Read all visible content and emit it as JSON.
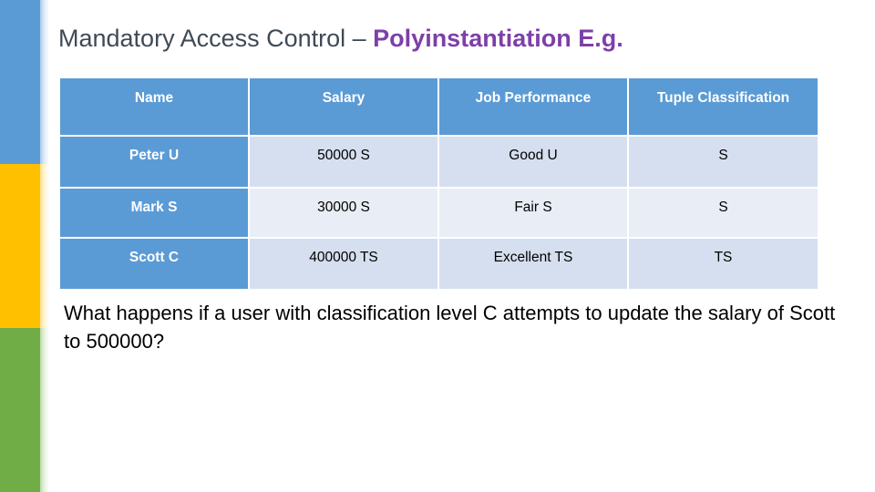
{
  "slide": {
    "title_main": "Mandatory Access Control – ",
    "title_accent": "Polyinstantiation E.g.",
    "question": "What happens if a user with classification level C attempts to update the salary of Scott to 500000?"
  },
  "decor": {
    "band_blue_color": "#5b9bd5",
    "band_yellow_color": "#ffc000",
    "band_green_color": "#70ad47"
  },
  "table": {
    "headers": [
      "Name",
      "Salary",
      "Job Performance",
      "Tuple Classification"
    ],
    "header_bg": "#5b9bd5",
    "header_text_color": "#ffffff",
    "name_column_bg": "#5b9bd5",
    "row_bg_odd": "#d6dfef",
    "row_bg_even": "#e9edf5",
    "rows": [
      {
        "name": "Peter   U",
        "salary": "50000  S",
        "job_performance": "Good   U",
        "tuple_classification": "S"
      },
      {
        "name": "Mark   S",
        "salary": "30000  S",
        "job_performance": "Fair      S",
        "tuple_classification": "S"
      },
      {
        "name": "Scott   C",
        "salary": "400000  TS",
        "job_performance": "Excellent   TS",
        "tuple_classification": "TS"
      }
    ]
  }
}
